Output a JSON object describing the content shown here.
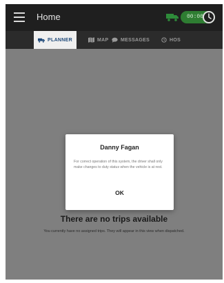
{
  "header": {
    "title": "Home",
    "clock_time": "00:00"
  },
  "tabs": [
    {
      "label": "PLANNER",
      "icon": "truck-icon",
      "active": true
    },
    {
      "label": "MAP",
      "icon": "map-icon",
      "active": false
    },
    {
      "label": "MESSAGES",
      "icon": "chat-icon",
      "active": false
    },
    {
      "label": "HOS",
      "icon": "clock-icon",
      "active": false
    }
  ],
  "main": {
    "empty_title": "There are no trips available",
    "empty_subtitle": "You currently have no assigned trips. They will appear in this view when dispatched."
  },
  "dialog": {
    "title": "Danny Fagan",
    "body": "For correct operation of this system, the driver shall only make changes to duty status when the vehicle is at rest.",
    "ok_label": "OK"
  },
  "colors": {
    "appbar": "#1f1f1f",
    "tabbar": "#2b2b2b",
    "active_tab_text": "#1f4a7a",
    "status_green": "#2e7d32",
    "truck_green": "#2e8b3a",
    "overlay": "#7f7f7f"
  }
}
